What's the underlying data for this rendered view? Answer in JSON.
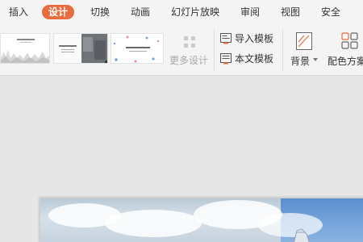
{
  "menu": {
    "items": [
      "插入",
      "设计",
      "切换",
      "动画",
      "幻灯片放映",
      "审阅",
      "视图",
      "安全"
    ],
    "active_index": 1,
    "active_color": "#e96c3e"
  },
  "ribbon": {
    "more_design_label": "更多设计",
    "import_template_label": "导入模板",
    "body_template_label": "本文模板",
    "background_label": "背景",
    "color_scheme_label": "配色方案"
  },
  "icons": {
    "more_design": "grid-icon",
    "import_template": "import-template-icon",
    "body_template": "document-template-icon",
    "background": "background-icon",
    "color_scheme": "color-scheme-icon",
    "background_dropdown": "chevron-down-icon"
  }
}
